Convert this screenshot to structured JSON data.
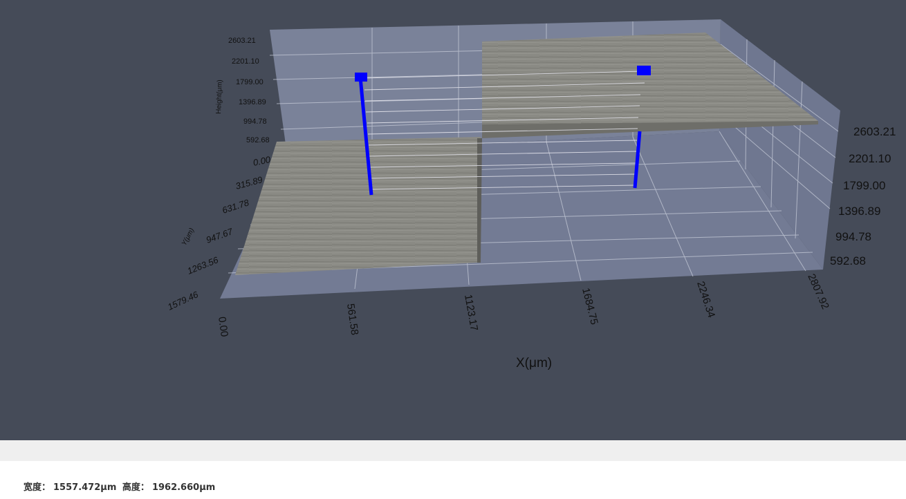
{
  "viewer": {
    "height_axis_label": "Height(μm)",
    "y_axis_label": "Y(μm)",
    "x_axis_label": "X(μm)",
    "z_ticks": [
      "2603.21",
      "2201.10",
      "1799.00",
      "1396.89",
      "994.78",
      "592.68"
    ],
    "x_ticks": [
      "0.00",
      "561.58",
      "1123.17",
      "1684.75",
      "2246.34",
      "2807.92"
    ],
    "y_ticks": [
      "0.00",
      "315.89",
      "631.78",
      "947.67",
      "1263.56",
      "1579.46"
    ],
    "colors": {
      "background": "#454b58",
      "panel": "#7c849d",
      "surface": "#8a8a84",
      "marker": "#0000ff"
    }
  },
  "info": {
    "width_label": "宽度：",
    "width_value": "1557.472μm",
    "height_label": "高度：",
    "height_value": "1962.660μm"
  }
}
